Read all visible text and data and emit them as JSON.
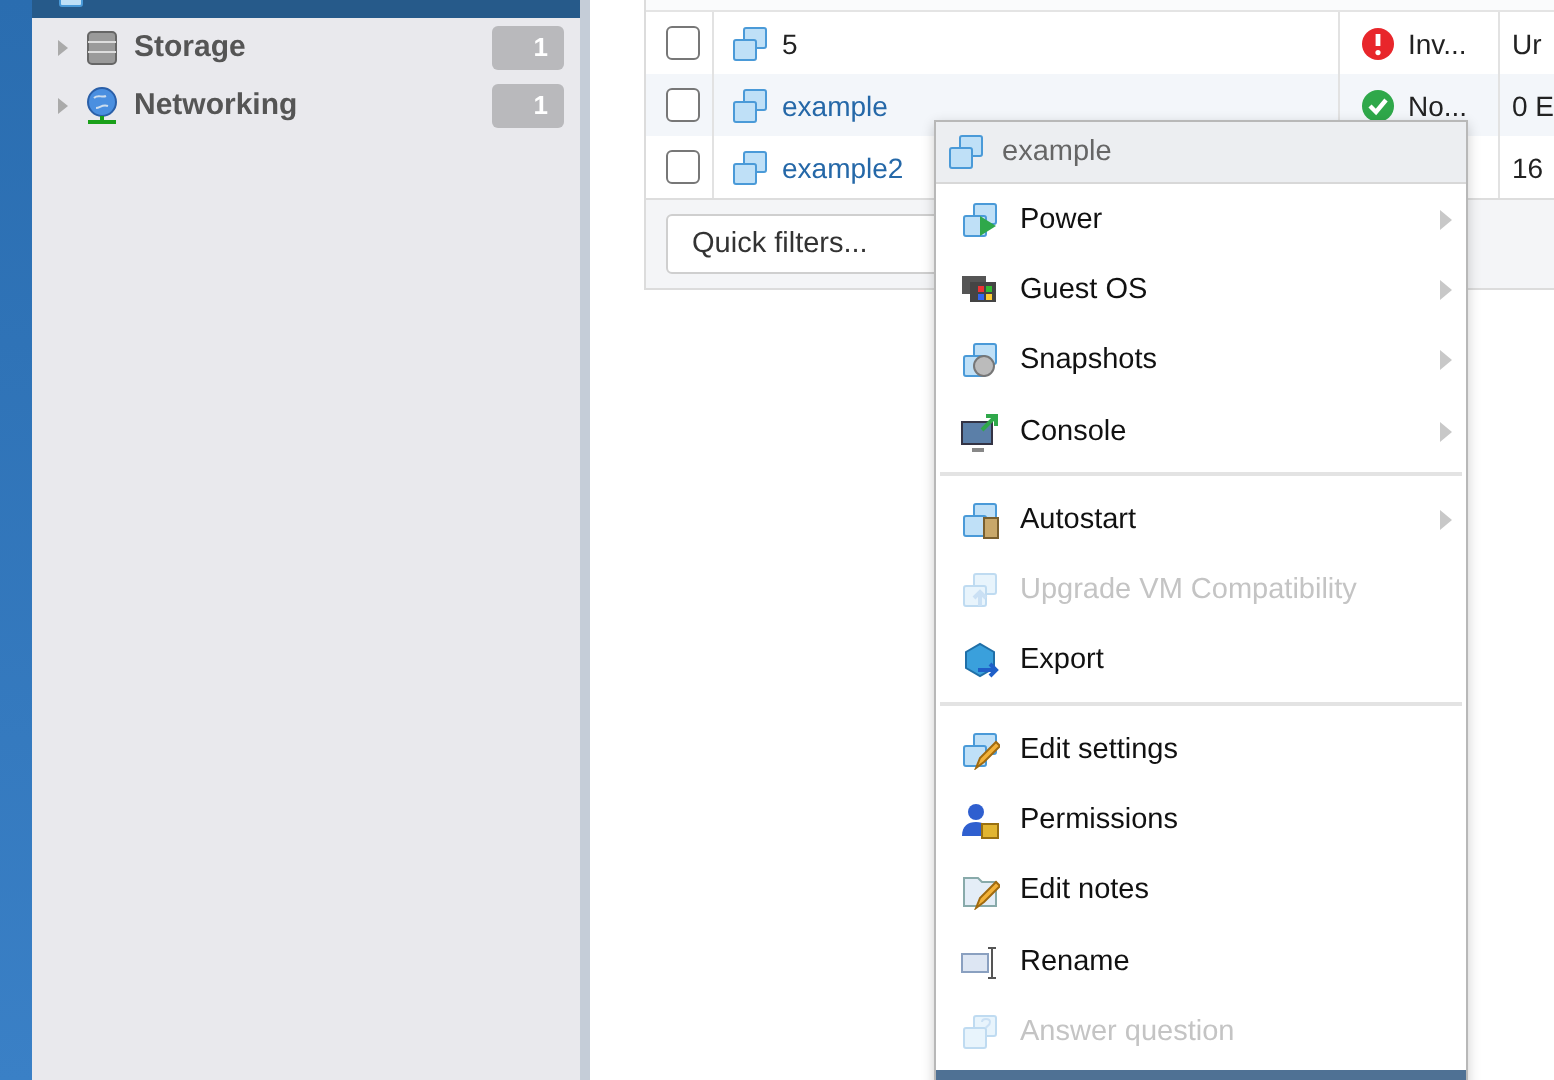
{
  "sidebar": {
    "items": [
      {
        "selected": true
      },
      {
        "label": "Storage",
        "count": "1",
        "selected": false
      },
      {
        "label": "Networking",
        "count": "1",
        "selected": false
      }
    ]
  },
  "table": {
    "rows": [
      {
        "checked": false,
        "name": "5",
        "link": false,
        "status": {
          "text": "Inv...",
          "ok": false
        },
        "column_4": "Ur"
      },
      {
        "checked": false,
        "name": "example",
        "link": true,
        "status": {
          "text": "No...",
          "ok": true
        },
        "column_4": "0 E"
      },
      {
        "checked": false,
        "name": "example2",
        "link": true,
        "column_4": "16"
      }
    ]
  },
  "quick_filters": {
    "placeholder": "Quick filters..."
  },
  "context_menu": {
    "title": "example",
    "items": [
      {
        "kind": "item",
        "label": "Power",
        "submenu": true,
        "disabled": false
      },
      {
        "kind": "item",
        "label": "Guest OS",
        "submenu": true,
        "disabled": false
      },
      {
        "kind": "item",
        "label": "Snapshots",
        "submenu": true,
        "disabled": false
      },
      {
        "kind": "item",
        "label": "Console",
        "submenu": true,
        "disabled": false
      },
      {
        "kind": "separator"
      },
      {
        "kind": "item",
        "label": "Autostart",
        "submenu": true,
        "disabled": false
      },
      {
        "kind": "item",
        "label": "Upgrade VM Compatibility",
        "submenu": false,
        "disabled": true
      },
      {
        "kind": "item",
        "label": "Export",
        "submenu": false,
        "disabled": false
      },
      {
        "kind": "separator"
      },
      {
        "kind": "item",
        "label": "Edit settings",
        "submenu": false,
        "disabled": false
      },
      {
        "kind": "item",
        "label": "Permissions",
        "submenu": false,
        "disabled": false
      },
      {
        "kind": "item",
        "label": "Edit notes",
        "submenu": false,
        "disabled": false
      },
      {
        "kind": "item",
        "label": "Rename",
        "submenu": false,
        "disabled": false
      },
      {
        "kind": "item",
        "label": "Answer question",
        "submenu": false,
        "disabled": true
      }
    ]
  }
}
